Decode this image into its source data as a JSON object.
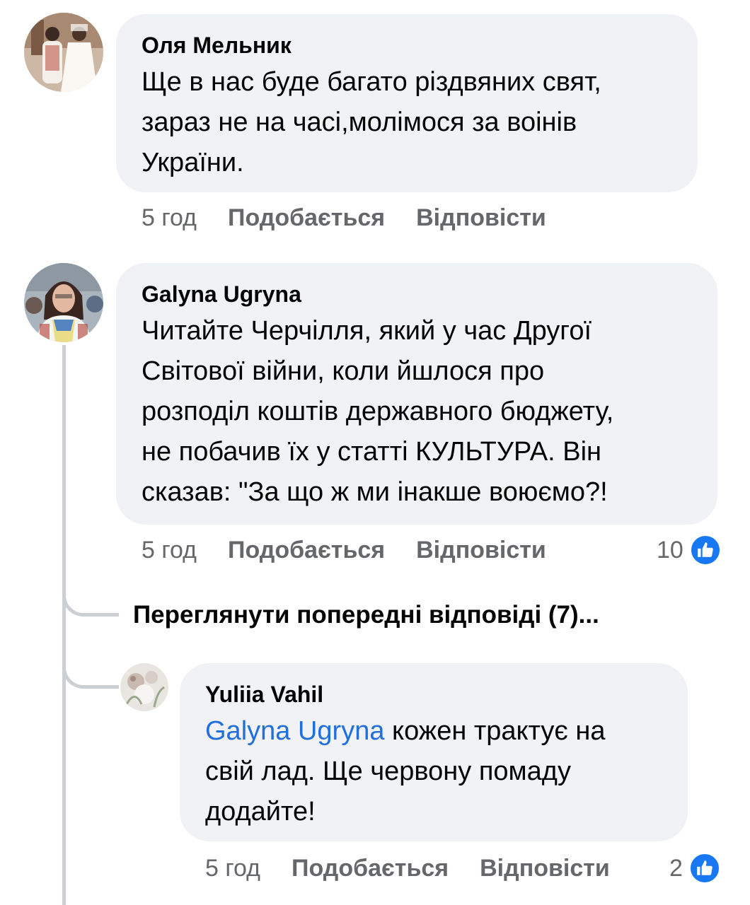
{
  "comments": [
    {
      "author": "Оля Мельник",
      "lines": [
        "Ще в нас буде багато різдвяних свят,",
        "зараз не на часі,молімося за воінів",
        "України."
      ],
      "time": "5 год",
      "like_label": "Подобається",
      "reply_label": "Відповісти",
      "avatar_icon": "avatar-photo-wedding"
    },
    {
      "author": "Galyna Ugryna",
      "lines": [
        "Читайте Черчілля, який у  час Другої",
        "Світової війни, коли йшлося про",
        "розподіл коштів державного бюджету,",
        "не побачив їх у статті КУЛЬТУРА. Він",
        "сказав: \"За що ж ми інакше воюємо?!"
      ],
      "time": "5 год",
      "like_label": "Подобається",
      "reply_label": "Відповісти",
      "reaction_count": "10",
      "reaction_icon": "like-icon",
      "avatar_icon": "avatar-photo-woman"
    }
  ],
  "view_previous_replies": "Переглянути попередні відповіді (7)...",
  "reply": {
    "author": "Yuliia Vahil",
    "mention": "Galyna Ugryna",
    "line1_rest": " кожен трактує на",
    "line2": "свій лад. Ще червону помаду",
    "line3": "додайте!",
    "time": "5 год",
    "like_label": "Подобається",
    "reply_label": "Відповісти",
    "reaction_count": "2",
    "reaction_icon": "like-icon",
    "avatar_icon": "avatar-photo-flowers"
  },
  "colors": {
    "bubble": "#f0f2f5",
    "meta_text": "#65676b",
    "mention": "#216fdb",
    "like_badge": "#1877f2",
    "thread_line": "#ccd0d5"
  }
}
